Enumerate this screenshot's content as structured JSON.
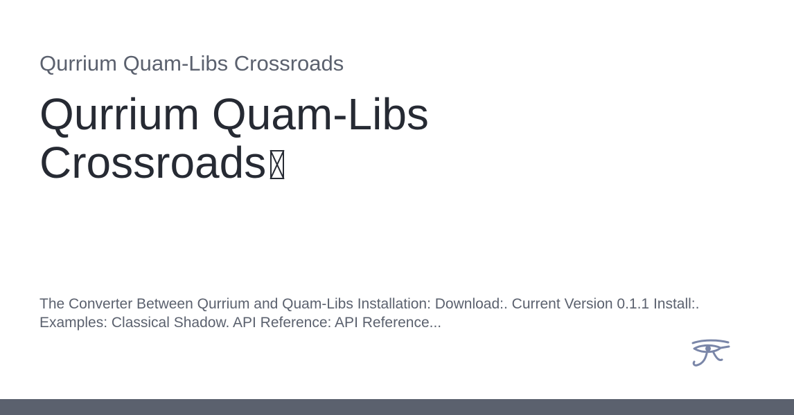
{
  "site": {
    "name": "Qurrium Quam-Libs Crossroads"
  },
  "page": {
    "title_text": "Qurrium Quam-Libs Crossroads",
    "description": "The Converter Between Qurrium and Quam-Libs Installation: Download:. Current Version 0.1.1 Install:. Examples: Classical Shadow. API Reference: API Reference..."
  },
  "icons": {
    "title_glyph": "missing-glyph-icon",
    "logo": "eye-of-horus-icon"
  },
  "colors": {
    "text_primary": "#262a33",
    "text_secondary": "#5b616e",
    "logo": "#7a86a8",
    "footer_bar": "#5b616e"
  }
}
